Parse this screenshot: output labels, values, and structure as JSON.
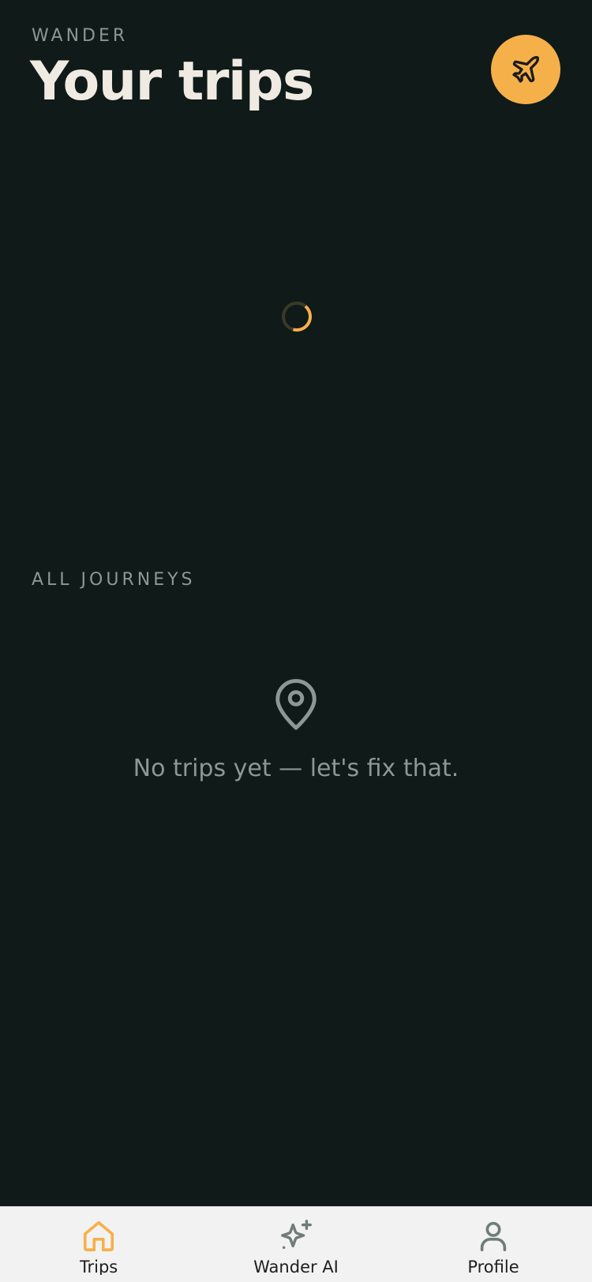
{
  "header": {
    "brand": "WANDER",
    "title": "Your trips",
    "fab_icon": "airplane-icon"
  },
  "section": {
    "label": "ALL JOURNEYS"
  },
  "empty_state": {
    "icon": "map-pin-icon",
    "message": "No trips yet — let's fix that."
  },
  "tabbar": {
    "tabs": [
      {
        "label": "Trips",
        "icon": "home-icon",
        "active": true
      },
      {
        "label": "Wander AI",
        "icon": "sparkles-icon",
        "active": false
      },
      {
        "label": "Profile",
        "icon": "user-icon",
        "active": false
      }
    ]
  },
  "colors": {
    "background": "#0f1a19",
    "accent": "#f6b04a",
    "muted": "#8c9893",
    "title": "#efebe2",
    "tabbar": "#f2f2f2"
  }
}
